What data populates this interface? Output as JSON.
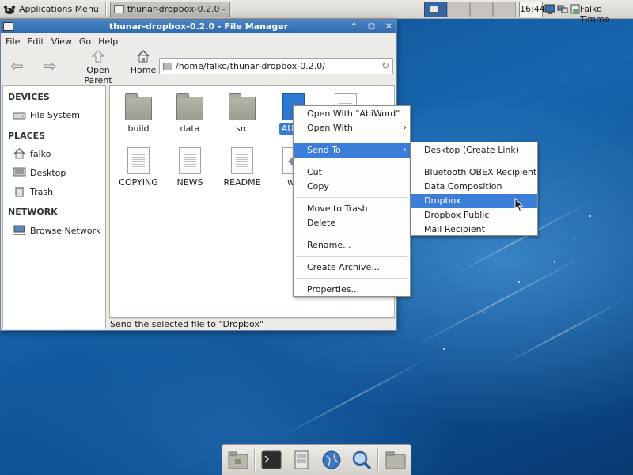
{
  "top_panel": {
    "apps_menu_label": "Applications Menu",
    "taskbar_window_label": "thunar-dropbox-0.2.0 - F...",
    "clock": "16:44",
    "user": "Falko Timme"
  },
  "window": {
    "title": "thunar-dropbox-0.2.0 - File Manager",
    "title_buttons": [
      "↑",
      "▢",
      "✕"
    ],
    "menu": [
      "File",
      "Edit",
      "View",
      "Go",
      "Help"
    ],
    "toolbar": {
      "back_glyph": "⇦",
      "forward_glyph": "⇨",
      "open_parent_label": "Open Parent",
      "home_label": "Home"
    },
    "location_path": "/home/falko/thunar-dropbox-0.2.0/",
    "sidebar": {
      "devices_header": "DEVICES",
      "file_system": "File System",
      "places_header": "PLACES",
      "falko": "falko",
      "desktop": "Desktop",
      "trash": "Trash",
      "network_header": "NETWORK",
      "browse_network": "Browse Network"
    },
    "files": {
      "build": "build",
      "data": "data",
      "src": "src",
      "authors": "AUTH",
      "copying": "COPYING",
      "news": "NEWS",
      "readme": "README",
      "waf": "wa"
    },
    "status": "Send the selected file to \"Dropbox\""
  },
  "context_menu": {
    "open_with_abiword": "Open With \"AbiWord\"",
    "open_with": "Open With",
    "send_to": "Send To",
    "cut": "Cut",
    "copy": "Copy",
    "move_to_trash": "Move to Trash",
    "delete": "Delete",
    "rename": "Rename...",
    "create_archive": "Create Archive...",
    "properties": "Properties..."
  },
  "send_to_menu": {
    "desktop_link": "Desktop (Create Link)",
    "bluetooth": "Bluetooth OBEX Recipient",
    "data_composition": "Data Composition",
    "dropbox": "Dropbox",
    "dropbox_public": "Dropbox Public",
    "mail_recipient": "Mail Recipient"
  },
  "colors": {
    "highlight": "#3b7dd8",
    "titlebar": "#3a77bb",
    "desktop": "#1766ae"
  },
  "dock_icons": [
    "folder-icon",
    "terminal-icon",
    "file-manager-icon",
    "web-browser-icon",
    "search-icon",
    "folder-icon"
  ]
}
